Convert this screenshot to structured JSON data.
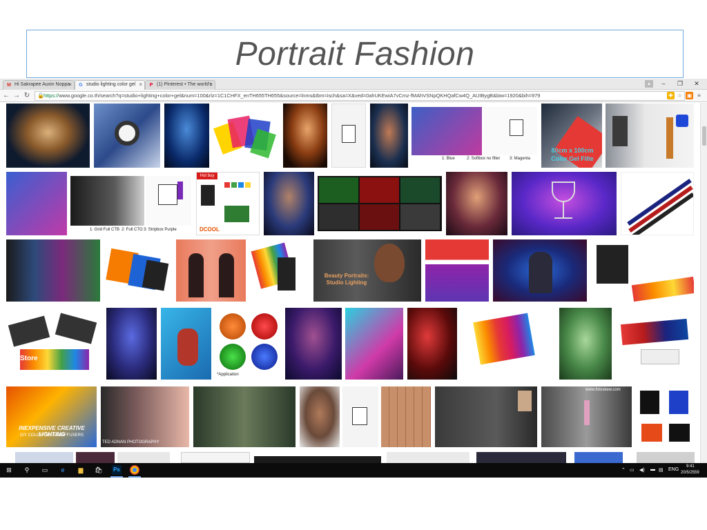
{
  "slide": {
    "title": "Portrait Fashion"
  },
  "browser": {
    "tabs": [
      {
        "label": "Hi Sakrapee Auxin Noppa",
        "icon": "gmail-icon",
        "active": false
      },
      {
        "label": "studio lighting color gel",
        "icon": "google-icon",
        "active": true
      },
      {
        "label": "(1) Pinterest • The world's",
        "icon": "pinterest-icon",
        "active": false
      }
    ],
    "url_scheme": "https://",
    "url_rest": "www.google.co.th/search?q=studio+lighting+color+gel&num=100&rlz=1C1CHFX_enTH655TH655&source=lnms&tbm=isch&sa=X&ved=0ahUKEwiA7vCmz-fMAhVSNpQKHQafCw4Q_AUIBygB&biw=1920&bih=979"
  },
  "image_texts": {
    "softbox_row1": [
      "1: Blue",
      "2: Softbox no filter",
      "3: Magenta"
    ],
    "gel_title": "80cm x 100cm Color Gel Filte",
    "strip_row2": [
      "1: Grid Full CTB",
      "2: Full CTO",
      "3: Stripbox Purple"
    ],
    "hot_buy": "Hot buy",
    "dcool": "DCOOL",
    "beauty": "Beauty Portraits: Studio Lighting",
    "application": "*Application",
    "store": "Store",
    "inexpensive_1": "INEXPENSIVE CREATIVE LIGHTING",
    "inexpensive_2": "DIY COLOR GELS & DIFFUSERS",
    "ted": "TED ADNAN PHOTOGRAPHY",
    "watermark": "www.fotoskew.com"
  },
  "taskbar": {
    "language": "ENG",
    "time": "9:41",
    "date": "20/5/2559"
  },
  "colors": {
    "title": "#555555",
    "title_border": "#6fa8dc",
    "taskbar": "#0b0b0b"
  }
}
